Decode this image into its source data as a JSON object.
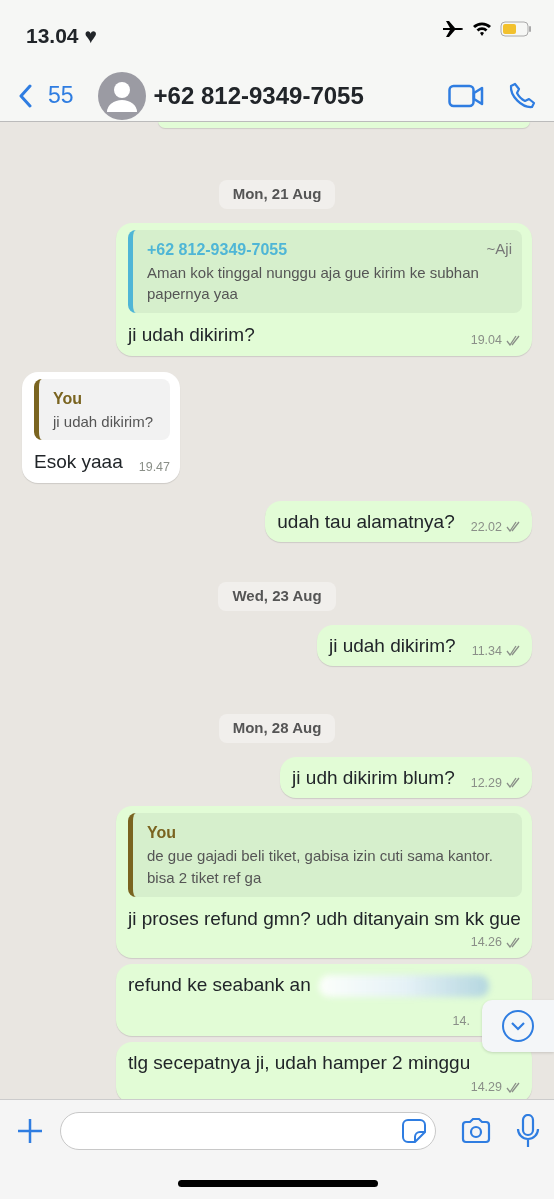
{
  "status_bar": {
    "time": "13.04",
    "heart": "♥"
  },
  "header": {
    "back_count": "55",
    "title": "+62 812-9349-7055"
  },
  "messages": [
    {
      "kind": "cut",
      "outgoing": true
    },
    {
      "kind": "date",
      "text": "Mon, 21 Aug"
    },
    {
      "kind": "message",
      "outgoing": true,
      "quote": {
        "author": "+62 812-9349-7055",
        "alias": "~Aji",
        "text": "Aman kok tinggal nunggu aja gue kirim ke subhan papernya yaa",
        "color": "#4fb6d6"
      },
      "text": "ji udah dikirim?",
      "time": "19.04",
      "read": false
    },
    {
      "kind": "message",
      "outgoing": false,
      "quote": {
        "author": "You",
        "text": "ji udah dikirim?",
        "color": "#7a6420"
      },
      "text": "Esok yaaa",
      "time": "19.47"
    },
    {
      "kind": "message",
      "outgoing": true,
      "text": "udah tau alamatnya?",
      "time": "22.02",
      "read": false
    },
    {
      "kind": "date",
      "text": "Wed, 23 Aug"
    },
    {
      "kind": "message",
      "outgoing": true,
      "text": "ji udah dikirim?",
      "time": "11.34",
      "read": false
    },
    {
      "kind": "date",
      "text": "Mon, 28 Aug"
    },
    {
      "kind": "message",
      "outgoing": true,
      "text": "ji udh dikirim blum?",
      "time": "12.29",
      "read": false
    },
    {
      "kind": "message",
      "outgoing": true,
      "quote": {
        "author": "You",
        "text": "de gue gajadi beli tiket, gabisa izin cuti sama kantor. bisa 2 tiket ref ga",
        "color": "#7a6420"
      },
      "text": "ji proses refund gmn? udh ditanyain sm kk gue",
      "time": "14.26",
      "read": false
    },
    {
      "kind": "message",
      "outgoing": true,
      "redacted": true,
      "text": "refund ke seabank an",
      "time": "14."
    },
    {
      "kind": "message",
      "outgoing": true,
      "text": "tlg secepatnya ji, udah hamper 2 minggu",
      "time": "14.29",
      "read": false
    }
  ]
}
